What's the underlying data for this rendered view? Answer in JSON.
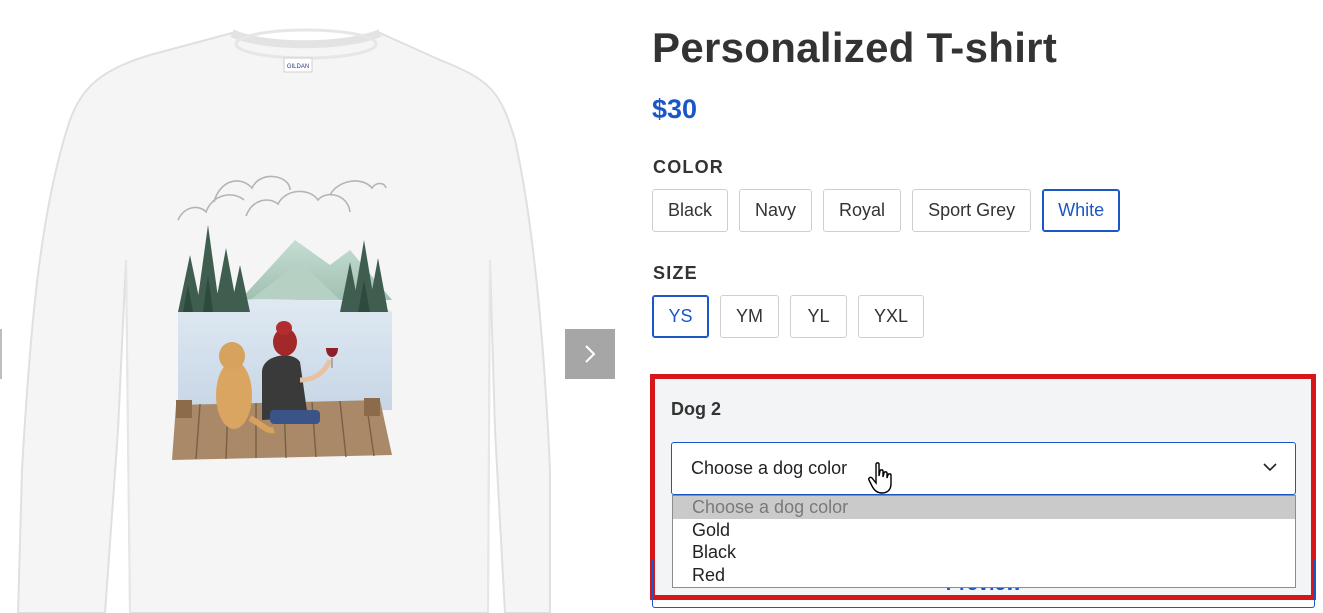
{
  "gallery": {
    "shirt_brand_tag": "GILDAN",
    "next_icon": "chevron-right-icon"
  },
  "product": {
    "title": "Personalized T-shirt",
    "price": "$30"
  },
  "color_option": {
    "label": "COLOR",
    "choices": [
      "Black",
      "Navy",
      "Royal",
      "Sport Grey",
      "White"
    ],
    "selected": "White"
  },
  "size_option": {
    "label": "SIZE",
    "choices": [
      "YS",
      "YM",
      "YL",
      "YXL"
    ],
    "selected": "YS"
  },
  "personalization": {
    "highlight_color": "#d7161a",
    "dog_label": "Dog 2",
    "select_value": "Choose a dog color",
    "options": [
      "Choose a dog color",
      "Gold",
      "Black",
      "Red"
    ],
    "preview_button": "Preview"
  },
  "colors": {
    "accent": "#1a56c8",
    "text": "#333333"
  }
}
